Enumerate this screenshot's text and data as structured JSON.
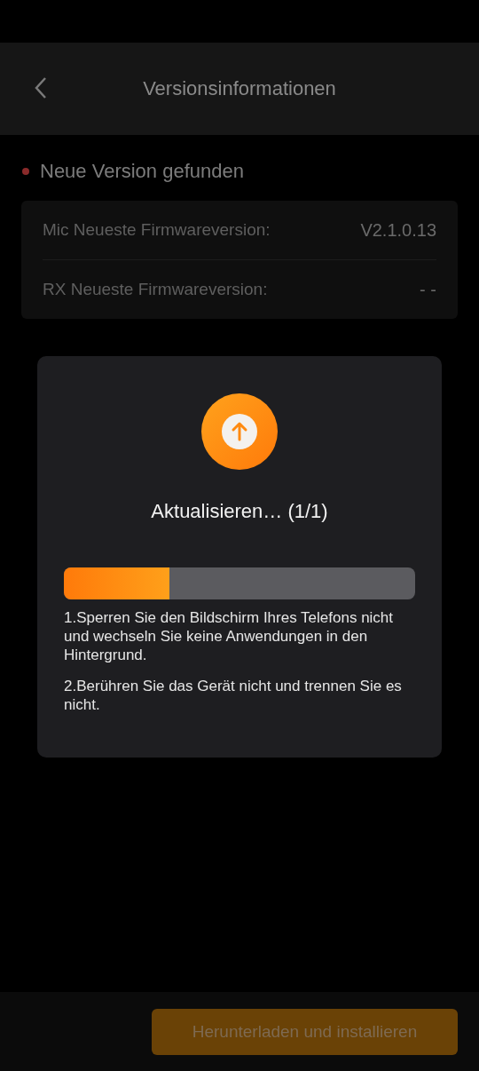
{
  "header": {
    "title": "Versionsinformationen"
  },
  "status": {
    "label": "Neue Version gefunden",
    "color": "#8a2a2a"
  },
  "versions": [
    {
      "label": "Mic Neueste Firmwareversion:",
      "value": "V2.1.0.13"
    },
    {
      "label": "RX Neueste Firmwareversion:",
      "value": "- -"
    }
  ],
  "dialog": {
    "title": "Aktualisieren… (1/1)",
    "progress": {
      "level": 0.3
    },
    "notes": [
      "1.Sperren Sie den Bildschirm Ihres Telefons nicht und wechseln Sie keine Anwendungen in den Hintergrund.",
      "2.Berühren Sie das Gerät nicht und trennen Sie es nicht."
    ]
  },
  "footer": {
    "button": {
      "label": "Herunterladen und installieren",
      "disabled": true
    }
  }
}
